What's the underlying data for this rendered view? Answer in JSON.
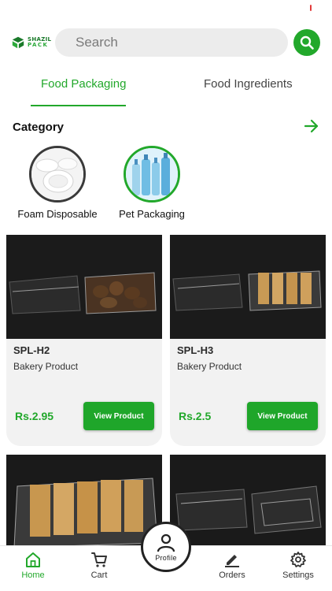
{
  "colors": {
    "accent": "#22a82b",
    "text": "#1a1a1a",
    "search_bg": "#ececec",
    "card_bg": "#f2f2f2"
  },
  "header": {
    "logo": {
      "line1": "SHAZIL",
      "line2": "PACK"
    },
    "search": {
      "placeholder": "Search",
      "icon": "search-icon"
    }
  },
  "tabs": [
    {
      "label": "Food Packaging",
      "active": true
    },
    {
      "label": "Food Ingredients",
      "active": false
    }
  ],
  "category": {
    "title": "Category",
    "arrow_icon": "arrow-right-icon",
    "items": [
      {
        "label": "Foam Disposable"
      },
      {
        "label": "Pet Packaging"
      }
    ]
  },
  "products": [
    {
      "sku": "SPL-H2",
      "category": "Bakery Product",
      "price": "Rs.2.95",
      "button": "View Product"
    },
    {
      "sku": "SPL-H3",
      "category": "Bakery Product",
      "price": "Rs.2.5",
      "button": "View Product"
    },
    {
      "sku": "",
      "category": "",
      "price": "",
      "button": ""
    },
    {
      "sku": "",
      "category": "",
      "price": "",
      "button": ""
    }
  ],
  "bottom_nav": {
    "home": {
      "label": "Home",
      "icon": "home-icon",
      "active": true
    },
    "cart": {
      "label": "Cart",
      "icon": "cart-icon"
    },
    "profile": {
      "label": "Profile",
      "icon": "user-icon"
    },
    "orders": {
      "label": "Orders",
      "icon": "pencil-icon"
    },
    "settings": {
      "label": "Settings",
      "icon": "gear-icon"
    }
  }
}
